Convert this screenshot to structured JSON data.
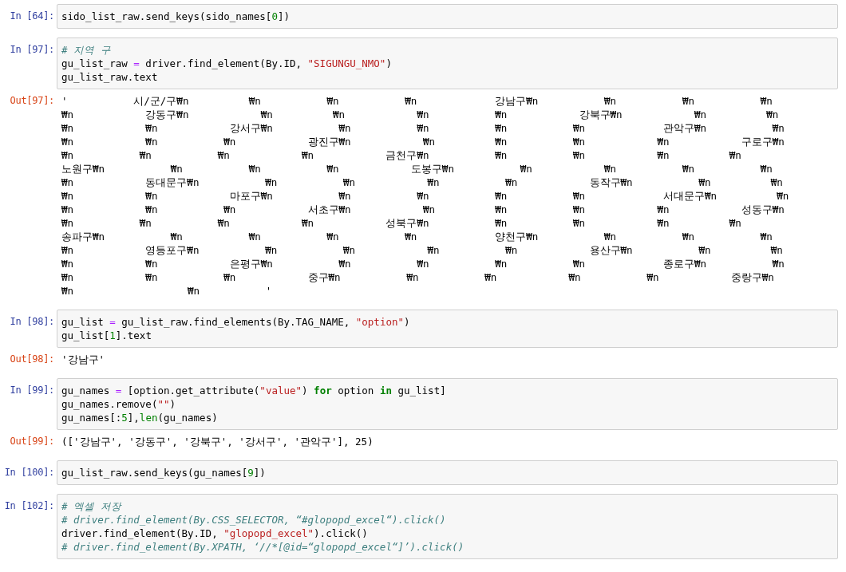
{
  "cells": [
    {
      "kind": "input",
      "prompt": "In [64]:",
      "lines": [
        [
          {
            "kind": "plain",
            "s": "sido_list_raw.send_keys(sido_names["
          },
          {
            "kind": "number",
            "s": "0"
          },
          {
            "kind": "plain",
            "s": "])"
          }
        ]
      ]
    },
    {
      "kind": "input",
      "prompt": "In [97]:",
      "lines": [
        [
          {
            "kind": "comment",
            "s": "# 지역 구"
          }
        ],
        [
          {
            "kind": "plain",
            "s": "gu_list_raw "
          },
          {
            "kind": "operator",
            "s": "="
          },
          {
            "kind": "plain",
            "s": " driver.find_element(By.ID, "
          },
          {
            "kind": "string",
            "s": "\"SIGUNGU_NMO\""
          },
          {
            "kind": "plain",
            "s": ")"
          }
        ],
        [
          {
            "kind": "plain",
            "s": "gu_list_raw.text"
          }
        ]
      ]
    },
    {
      "kind": "output",
      "prompt": "Out[97]:",
      "lines": [
        "'           시/군/구₩n          ₩n           ₩n           ₩n             강남구₩n           ₩n           ₩n           ₩n",
        "₩n            강동구₩n            ₩n          ₩n            ₩n           ₩n            강북구₩n            ₩n          ₩n",
        "₩n            ₩n            강서구₩n           ₩n           ₩n           ₩n           ₩n             관악구₩n           ₩n",
        "₩n            ₩n           ₩n            광진구₩n            ₩n          ₩n           ₩n            ₩n            구로구₩n",
        "₩n           ₩n           ₩n            ₩n            금천구₩n           ₩n           ₩n            ₩n          ₩n",
        "노원구₩n           ₩n           ₩n           ₩n            도봉구₩n           ₩n            ₩n           ₩n           ₩n",
        "₩n            동대문구₩n           ₩n           ₩n            ₩n           ₩n            동작구₩n           ₩n          ₩n",
        "₩n            ₩n            마포구₩n           ₩n           ₩n           ₩n           ₩n             서대문구₩n          ₩n",
        "₩n            ₩n           ₩n            서초구₩n            ₩n          ₩n           ₩n            ₩n            성동구₩n",
        "₩n           ₩n           ₩n            ₩n            성북구₩n           ₩n           ₩n            ₩n          ₩n",
        "송파구₩n           ₩n           ₩n           ₩n           ₩n             양천구₩n           ₩n           ₩n           ₩n",
        "₩n            영등포구₩n           ₩n           ₩n            ₩n           ₩n            용산구₩n           ₩n          ₩n",
        "₩n            ₩n            은평구₩n           ₩n           ₩n           ₩n           ₩n             종로구₩n           ₩n",
        "₩n            ₩n           ₩n            중구₩n           ₩n           ₩n            ₩n           ₩n            중랑구₩n",
        "₩n                   ₩n           '"
      ]
    },
    {
      "kind": "input",
      "prompt": "In [98]:",
      "lines": [
        [
          {
            "kind": "plain",
            "s": "gu_list "
          },
          {
            "kind": "operator",
            "s": "="
          },
          {
            "kind": "plain",
            "s": " gu_list_raw.find_elements(By.TAG_NAME, "
          },
          {
            "kind": "string",
            "s": "\"option\""
          },
          {
            "kind": "plain",
            "s": ")"
          }
        ],
        [
          {
            "kind": "plain",
            "s": "gu_list["
          },
          {
            "kind": "number",
            "s": "1"
          },
          {
            "kind": "plain",
            "s": "].text"
          }
        ]
      ]
    },
    {
      "kind": "output",
      "prompt": "Out[98]:",
      "lines": [
        "'강남구'"
      ]
    },
    {
      "kind": "input",
      "prompt": "In [99]:",
      "lines": [
        [
          {
            "kind": "plain",
            "s": "gu_names "
          },
          {
            "kind": "operator",
            "s": "="
          },
          {
            "kind": "plain",
            "s": " [option.get_attribute("
          },
          {
            "kind": "string",
            "s": "\"value\""
          },
          {
            "kind": "plain",
            "s": ") "
          },
          {
            "kind": "keyword",
            "s": "for"
          },
          {
            "kind": "plain",
            "s": " option "
          },
          {
            "kind": "keyword",
            "s": "in"
          },
          {
            "kind": "plain",
            "s": " gu_list]"
          }
        ],
        [
          {
            "kind": "plain",
            "s": "gu_names.remove("
          },
          {
            "kind": "string",
            "s": "\"\""
          },
          {
            "kind": "plain",
            "s": ")"
          }
        ],
        [
          {
            "kind": "plain",
            "s": "gu_names[:"
          },
          {
            "kind": "number",
            "s": "5"
          },
          {
            "kind": "plain",
            "s": "],"
          },
          {
            "kind": "builtin",
            "s": "len"
          },
          {
            "kind": "plain",
            "s": "(gu_names)"
          }
        ]
      ]
    },
    {
      "kind": "output",
      "prompt": "Out[99]:",
      "lines": [
        "(['강남구', '강동구', '강북구', '강서구', '관악구'], 25)"
      ]
    },
    {
      "kind": "input",
      "prompt": "In [100]:",
      "lines": [
        [
          {
            "kind": "plain",
            "s": "gu_list_raw.send_keys(gu_names["
          },
          {
            "kind": "number",
            "s": "9"
          },
          {
            "kind": "plain",
            "s": "])"
          }
        ]
      ]
    },
    {
      "kind": "input",
      "prompt": "In [102]:",
      "lines": [
        [
          {
            "kind": "comment",
            "s": "# 엑셀 저장"
          }
        ],
        [
          {
            "kind": "comment",
            "s": "# driver.find_element(By.CSS_SELECTOR, “#glopopd_excel“).click()"
          }
        ],
        [
          {
            "kind": "plain",
            "s": "driver.find_element(By.ID, "
          },
          {
            "kind": "string",
            "s": "\"glopopd_excel\""
          },
          {
            "kind": "plain",
            "s": ").click()"
          }
        ],
        [
          {
            "kind": "comment",
            "s": "# driver.find_element(By.XPATH, ‘//*[@id=“glopopd_excel“]’).click()"
          }
        ]
      ]
    }
  ]
}
